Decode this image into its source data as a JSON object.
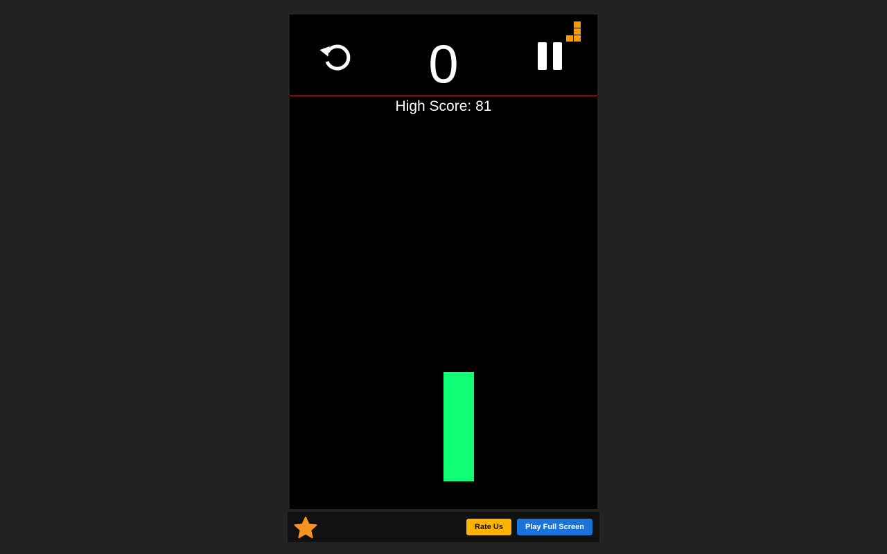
{
  "hud": {
    "score": "0",
    "high_score_text": "High Score: 81",
    "restart_icon": "restart-icon",
    "pause_icon": "pause-icon",
    "logo_icon": "orange-block-logo-icon"
  },
  "game": {
    "paddle_color": "#11ff77",
    "divider_color": "#c0392b"
  },
  "footer": {
    "star_icon": "star-icon",
    "rate_label": "Rate Us",
    "fullscreen_label": "Play Full Screen",
    "rate_color": "#ffb300",
    "fullscreen_color": "#1a73d9"
  }
}
